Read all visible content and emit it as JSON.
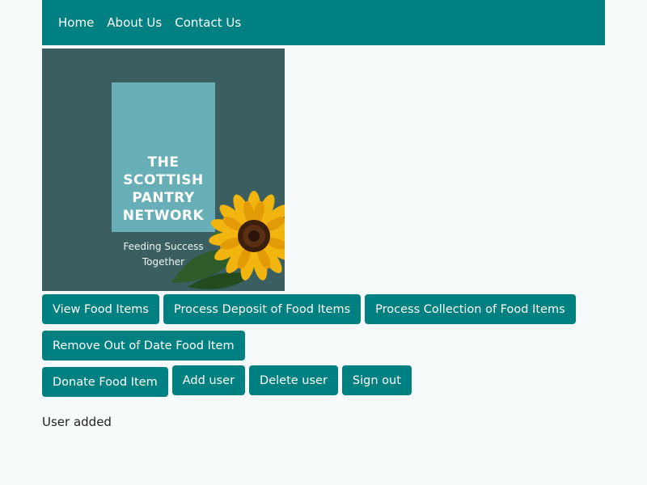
{
  "nav": {
    "items": [
      {
        "label": "Home"
      },
      {
        "label": "About Us"
      },
      {
        "label": "Contact Us"
      }
    ]
  },
  "logo": {
    "title_lines": [
      "THE",
      "SCOTTISH",
      "PANTRY",
      "NETWORK"
    ],
    "tagline_lines": [
      "Feeding Success",
      "Together"
    ],
    "colors": {
      "background": "#3b5f60",
      "panel": "#68aeb7"
    }
  },
  "buttons": {
    "view_food_items": "View Food Items",
    "process_deposit": "Process Deposit of Food Items",
    "process_collection": "Process Collection of Food Items",
    "remove_out_of_date": "Remove Out of Date Food Item",
    "donate_food_item": "Donate Food Item",
    "add_user": "Add user",
    "delete_user": "Delete user",
    "sign_out": "Sign out"
  },
  "status": {
    "message": "User added"
  },
  "theme": {
    "accent": "#008080",
    "page_background": "#f7fafa"
  }
}
